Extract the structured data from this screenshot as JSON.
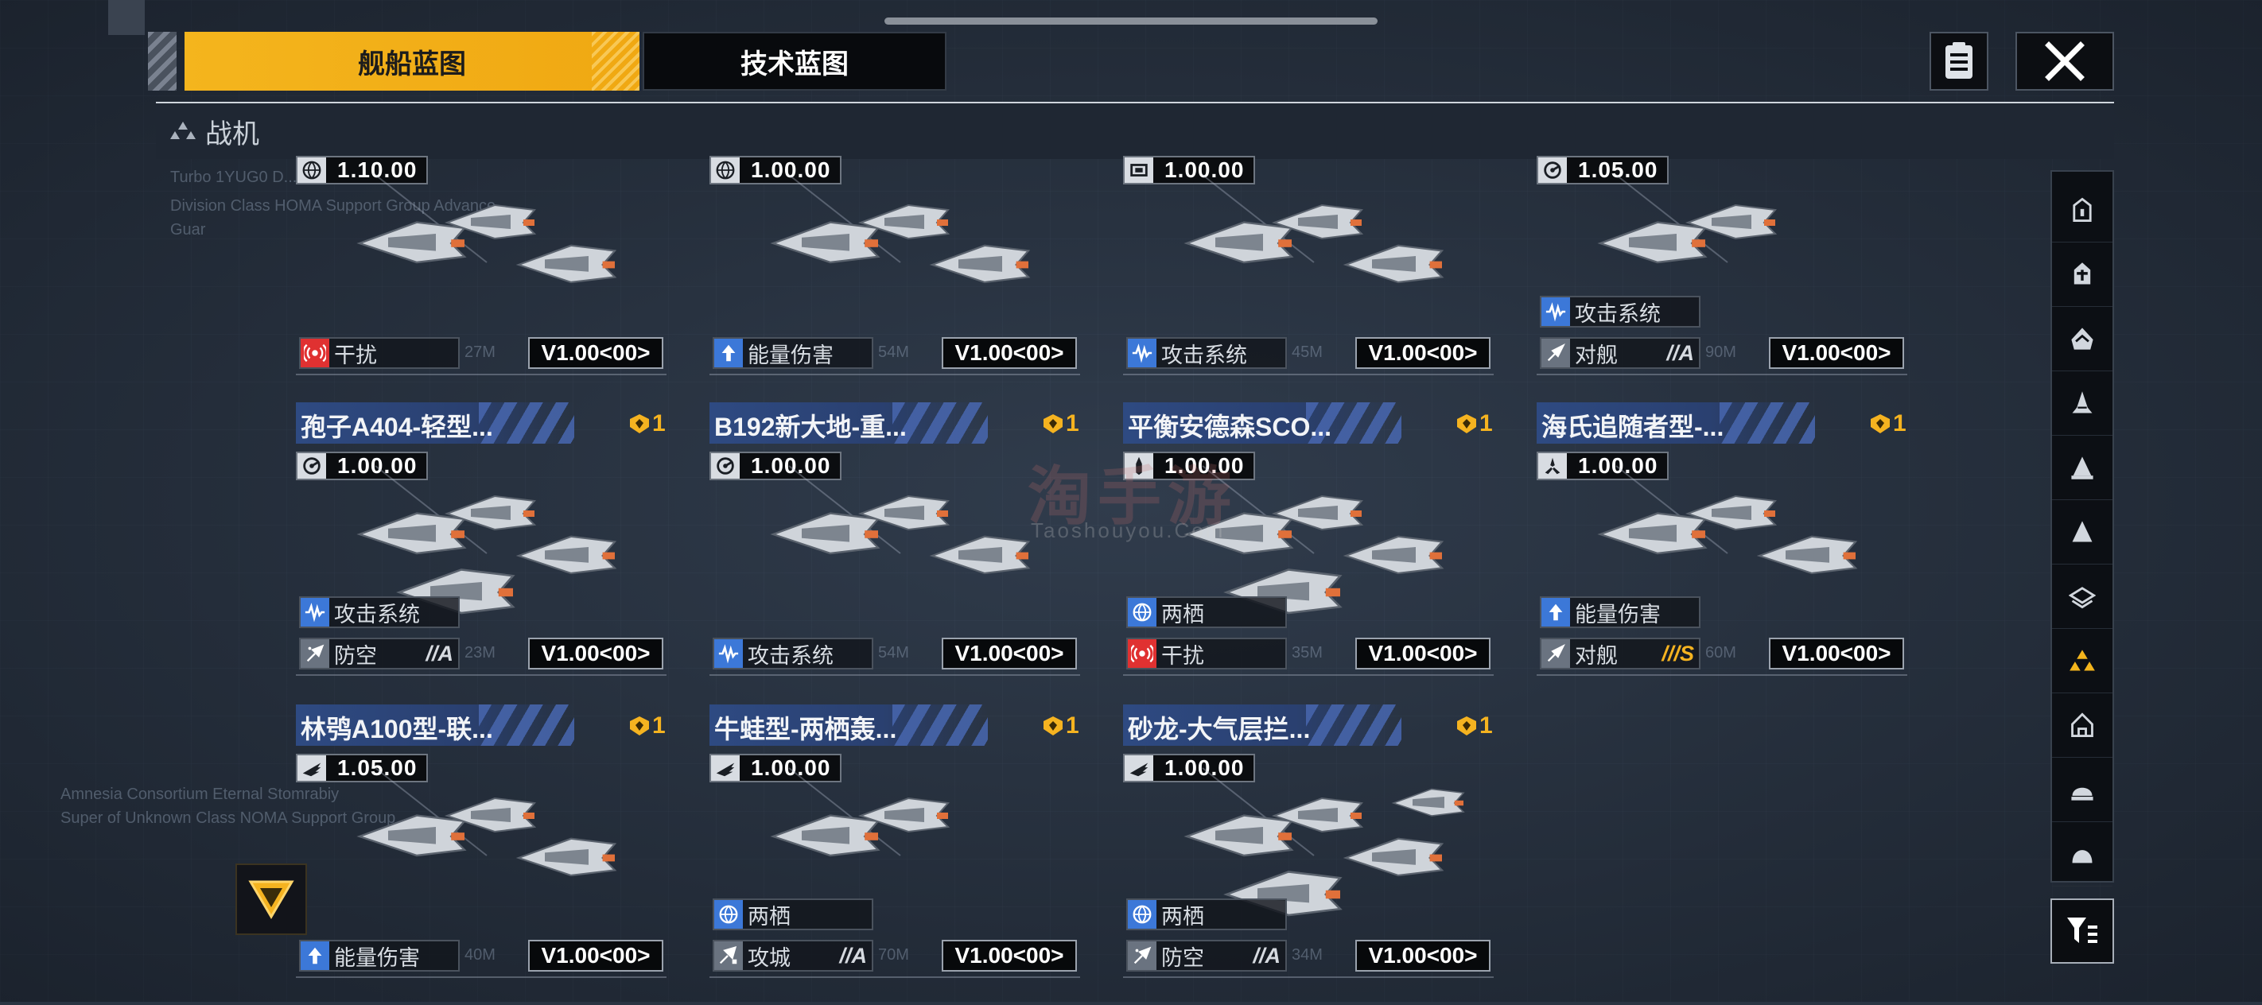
{
  "colors": {
    "accent": "#f4b51d",
    "panel": "#0b0d10",
    "header_blue": "#2e4a82",
    "damage_red": "#e03131",
    "attack_blue": "#3c78d8",
    "gold": "#f5b320"
  },
  "tabs": [
    {
      "label": "舰船蓝图",
      "active": true
    },
    {
      "label": "技术蓝图",
      "active": false
    }
  ],
  "top_buttons": {
    "notes_icon": "clipboard-list-icon",
    "close_icon": "close-x-icon"
  },
  "category": {
    "title": "战机",
    "icon": "fighter-class-icon"
  },
  "watermark": {
    "main": "淘手游",
    "sub": "Taoshouyou.Com"
  },
  "background_notes": [
    "Turbo 1YUG0 D...",
    "Division Class HOMA Support Group Advance...",
    "Guar",
    "Amnesia Consortium Eternal Stomrabiy",
    "Super of Unknown Class NOMA Support Group"
  ],
  "cards": [
    {
      "name": "",
      "badge": "",
      "version": "1.10.00",
      "ver_icon": "globe-icon",
      "ships": 3,
      "tags": [],
      "bottom_tag": {
        "label": "干扰",
        "icon": "jamming-icon",
        "color": "#e03131"
      },
      "dist": "27M",
      "price": "V1.00<00>",
      "grade": ""
    },
    {
      "name": "",
      "badge": "",
      "version": "1.00.00",
      "ver_icon": "globe-icon",
      "ships": 3,
      "tags": [],
      "bottom_tag": {
        "label": "能量伤害",
        "icon": "energy-up-icon",
        "color": "#3c78d8"
      },
      "dist": "54M",
      "price": "V1.00<00>",
      "grade": ""
    },
    {
      "name": "",
      "badge": "",
      "version": "1.00.00",
      "ver_icon": "module-icon",
      "ships": 3,
      "tags": [],
      "bottom_tag": {
        "label": "攻击系统",
        "icon": "attack-wave-icon",
        "color": "#3c78d8"
      },
      "dist": "45M",
      "price": "V1.00<00>",
      "grade": ""
    },
    {
      "name": "",
      "badge": "",
      "version": "1.05.00",
      "ver_icon": "radar-icon",
      "ships": 2,
      "tags": [
        {
          "label": "攻击系统",
          "icon": "attack-wave-icon",
          "color": "#3c78d8"
        }
      ],
      "bottom_tag": {
        "label": "对舰",
        "icon": "anti-ship-icon",
        "color": "#6a7380"
      },
      "dist": "90M",
      "price": "V1.00<00>",
      "grade": "//A"
    },
    {
      "name": "孢子A404-轻型...",
      "badge": "1",
      "version": "1.00.00",
      "ver_icon": "radar-icon",
      "ships": 4,
      "tags": [
        {
          "label": "攻击系统",
          "icon": "attack-wave-icon",
          "color": "#3c78d8"
        }
      ],
      "bottom_tag": {
        "label": "防空",
        "icon": "anti-air-icon",
        "color": "#6a7380"
      },
      "dist": "23M",
      "price": "V1.00<00>",
      "grade": "//A"
    },
    {
      "name": "B192新大地-重...",
      "badge": "1",
      "version": "1.00.00",
      "ver_icon": "radar-icon",
      "ships": 3,
      "tags": [],
      "bottom_tag": {
        "label": "攻击系统",
        "icon": "attack-wave-icon",
        "color": "#3c78d8"
      },
      "dist": "54M",
      "price": "V1.00<00>",
      "grade": ""
    },
    {
      "name": "平衡安德森SCO...",
      "badge": "1",
      "version": "1.00.00",
      "ver_icon": "missile-icon",
      "ships": 4,
      "tags": [
        {
          "label": "两栖",
          "icon": "amphibious-globe-icon",
          "color": "#3c78d8"
        }
      ],
      "bottom_tag": {
        "label": "干扰",
        "icon": "jamming-icon",
        "color": "#e03131"
      },
      "dist": "35M",
      "price": "V1.00<00>",
      "grade": ""
    },
    {
      "name": "海氏追随者型-...",
      "badge": "1",
      "version": "1.00.00",
      "ver_icon": "tri-blade-icon",
      "ships": 3,
      "tags": [
        {
          "label": "能量伤害",
          "icon": "energy-up-icon",
          "color": "#3c78d8"
        }
      ],
      "bottom_tag": {
        "label": "对舰",
        "icon": "anti-ship-icon",
        "color": "#6a7380"
      },
      "dist": "60M",
      "price": "V1.00<00>",
      "grade": "///S"
    },
    {
      "name": "林鸮A100型-联...",
      "badge": "1",
      "version": "1.05.00",
      "ver_icon": "wing-icon",
      "ships": 3,
      "tags": [],
      "bottom_tag": {
        "label": "能量伤害",
        "icon": "energy-up-icon",
        "color": "#3c78d8"
      },
      "dist": "40M",
      "price": "V1.00<00>",
      "grade": ""
    },
    {
      "name": "牛蛙型-两栖轰...",
      "badge": "1",
      "version": "1.00.00",
      "ver_icon": "wing-icon",
      "ships": 2,
      "tags": [
        {
          "label": "两栖",
          "icon": "amphibious-globe-icon",
          "color": "#3c78d8"
        }
      ],
      "bottom_tag": {
        "label": "攻城",
        "icon": "siege-icon",
        "color": "#6a7380"
      },
      "dist": "70M",
      "price": "V1.00<00>",
      "grade": "//A"
    },
    {
      "name": "砂龙-大气层拦...",
      "badge": "1",
      "version": "1.00.00",
      "ver_icon": "wing-icon",
      "ships": 5,
      "tags": [
        {
          "label": "两栖",
          "icon": "amphibious-globe-icon",
          "color": "#3c78d8"
        }
      ],
      "bottom_tag": {
        "label": "防空",
        "icon": "anti-air-icon",
        "color": "#6a7380"
      },
      "dist": "34M",
      "price": "V1.00<00>",
      "grade": "//A"
    }
  ],
  "filters": [
    {
      "icon": "frigate-icon",
      "active": false
    },
    {
      "icon": "destroyer-icon",
      "active": false
    },
    {
      "icon": "cruiser-icon",
      "active": false
    },
    {
      "icon": "battlecruiser-icon",
      "active": false
    },
    {
      "icon": "auxiliary-icon",
      "active": false
    },
    {
      "icon": "carrier-icon",
      "active": false
    },
    {
      "icon": "battleship-icon",
      "active": false
    },
    {
      "icon": "fighter-icon",
      "active": true
    },
    {
      "icon": "corvette-icon",
      "active": false
    },
    {
      "icon": "gunship-icon",
      "active": false
    },
    {
      "icon": "dome-icon",
      "active": false
    }
  ],
  "filter_button": {
    "icon": "filter-funnel-icon"
  },
  "collapse_button": {
    "icon": "collapse-triangle-icon"
  }
}
